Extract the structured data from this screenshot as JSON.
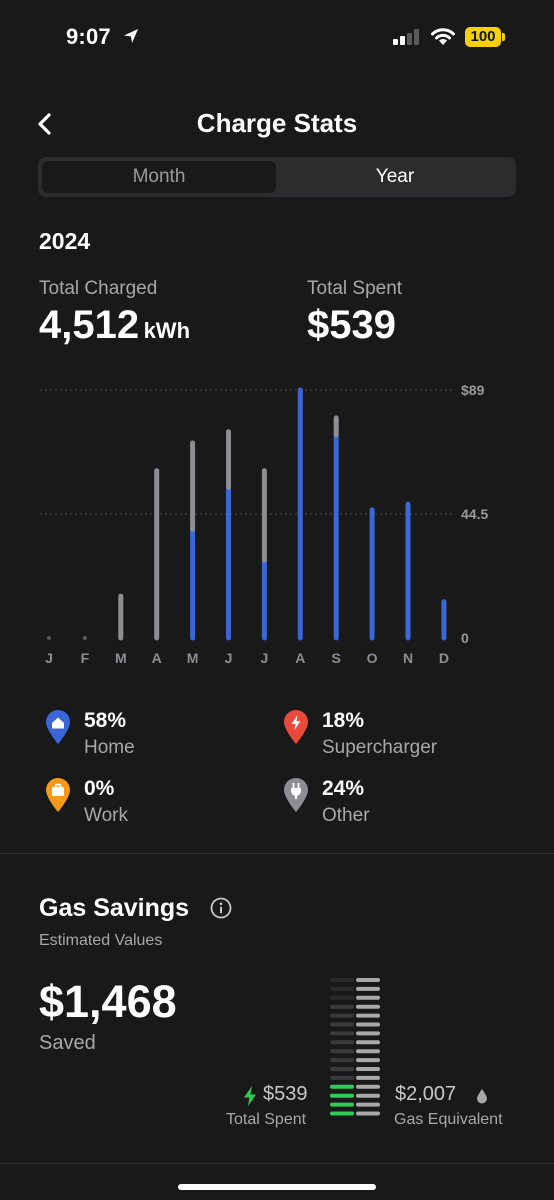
{
  "status_bar": {
    "time": "9:07",
    "battery": "100"
  },
  "header": {
    "title": "Charge Stats",
    "back_icon": "chevron-left-icon"
  },
  "segment": {
    "options": [
      "Month",
      "Year"
    ],
    "selected": "Year"
  },
  "summary": {
    "year": "2024",
    "total_charged_label": "Total Charged",
    "total_charged_value": "4,512",
    "total_charged_unit": "kWh",
    "total_spent_label": "Total Spent",
    "total_spent_value": "$539"
  },
  "colors": {
    "home": "#3a66d8",
    "supercharger": "#e84a3c",
    "work": "#f49a1a",
    "other": "#8e8e92",
    "accent_green": "#2ecc59",
    "background": "#19191a"
  },
  "chart_data": {
    "type": "bar",
    "stacked": true,
    "categories": [
      "J",
      "F",
      "M",
      "A",
      "M",
      "J",
      "J",
      "A",
      "S",
      "O",
      "N",
      "D"
    ],
    "series": [
      {
        "name": "Home",
        "values": [
          0,
          0,
          0,
          0,
          39,
          54,
          28,
          89,
          73,
          46,
          48,
          13
        ]
      },
      {
        "name": "Other",
        "values": [
          0,
          0,
          15,
          60,
          31,
          20,
          32,
          0,
          6,
          0,
          0,
          0
        ]
      }
    ],
    "ylim": [
      0,
      89
    ],
    "yticks": [
      "$89",
      "44.5",
      "0"
    ],
    "grid": true
  },
  "legend": [
    {
      "pct": "58%",
      "label": "Home",
      "icon": "home-icon"
    },
    {
      "pct": "18%",
      "label": "Supercharger",
      "icon": "bolt-icon"
    },
    {
      "pct": "0%",
      "label": "Work",
      "icon": "briefcase-icon"
    },
    {
      "pct": "24%",
      "label": "Other",
      "icon": "plug-icon"
    }
  ],
  "gas": {
    "title": "Gas Savings",
    "subtitle": "Estimated Values",
    "saved_amount": "$1,468",
    "saved_label": "Saved",
    "spent_amount": "$539",
    "spent_label": "Total Spent",
    "gas_amount": "$2,007",
    "gas_label": "Gas Equivalent",
    "spent_fraction": 0.27
  }
}
